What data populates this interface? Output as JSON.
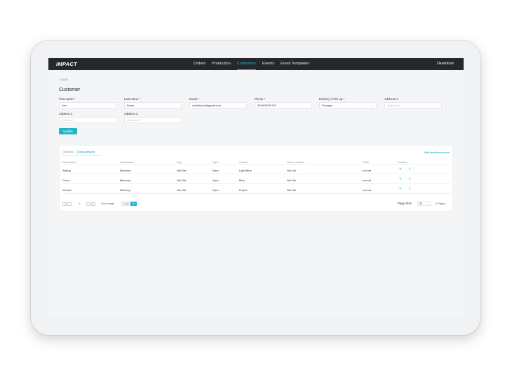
{
  "header": {
    "logo": "IMPACT",
    "account": "Deventure",
    "nav": [
      "Orders",
      "Production",
      "Customers",
      "Events",
      "Email Templates"
    ]
  },
  "back_label": "< Back",
  "page_title": "Customer",
  "form": {
    "first_name": {
      "label": "First name *",
      "value": "Amr"
    },
    "last_name": {
      "label": "Last name *",
      "value": "Burke"
    },
    "email": {
      "label": "Email *",
      "value": "AmeBurke@gmail.com"
    },
    "phone": {
      "label": "Phone *",
      "value": "353876091729"
    },
    "delivery": {
      "label": "Delivery / Pick up *",
      "value": "Postage"
    },
    "address1": {
      "label": "Address 1",
      "placeholder": "Address 1"
    },
    "address2": {
      "label": "Address 2",
      "placeholder": "Address 2"
    },
    "address3": {
      "label": "Address 3",
      "placeholder": "Address 3"
    },
    "update_label": "Update"
  },
  "tabs": [
    "Orders",
    "Consumers"
  ],
  "add_person_label": "Add another person",
  "table": {
    "columns": [
      "First Name",
      "Last Name",
      "Age",
      "Type",
      "Colour",
      "Scan Location",
      "Scan",
      "Actions"
    ],
    "rows": [
      [
        "Aisling",
        "Maloney",
        "Not Set",
        "Npro",
        "Light Blue",
        "Not Set",
        "not set"
      ],
      [
        "Conor",
        "Maloney",
        "Not Set",
        "Npro",
        "Blue",
        "Not Set",
        "not set"
      ],
      [
        "Sinead",
        "Maloney",
        "Not Set",
        "Npro",
        "Purple",
        "Not Set",
        "not set"
      ]
    ]
  },
  "pagination": {
    "current_page": "1",
    "go_to_label": "Go to page",
    "page_placeholder": "Page",
    "go_label": "Go",
    "page_size_label": "Page Size",
    "page_size": "50",
    "pages_label": "0 Pages"
  }
}
